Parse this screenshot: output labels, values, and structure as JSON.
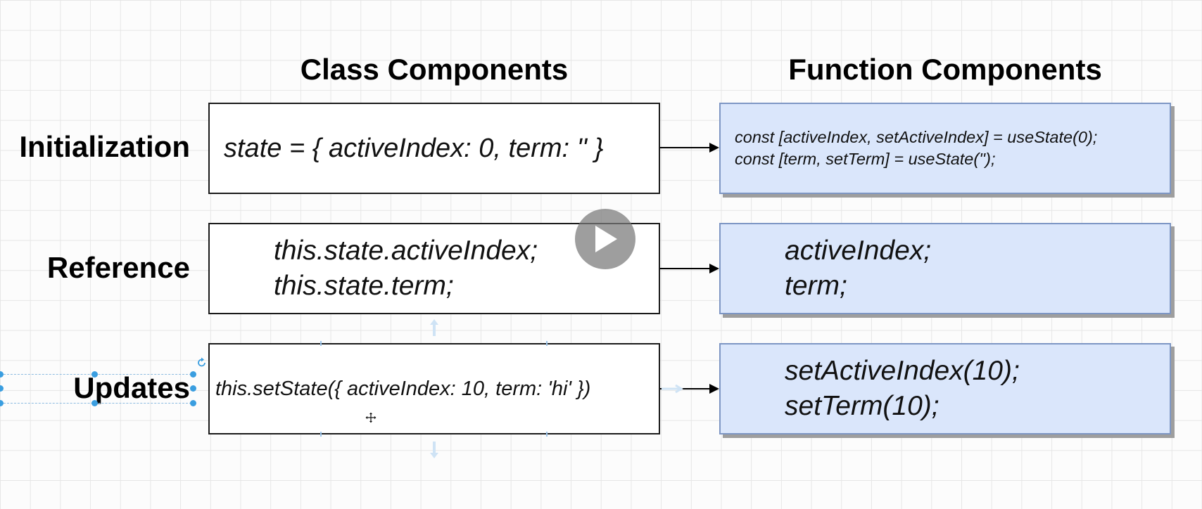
{
  "columns": {
    "class": "Class Components",
    "function": "Function Components"
  },
  "rows": [
    {
      "label": "Initialization",
      "class_lines": [
        "state = { activeIndex: 0, term: '' }"
      ],
      "function_lines": [
        "const [activeIndex, setActiveIndex] = useState(0);",
        "const [term, setTerm] = useState('');"
      ]
    },
    {
      "label": "Reference",
      "class_lines": [
        "this.state.activeIndex;",
        "this.state.term;"
      ],
      "function_lines": [
        "activeIndex;",
        "term;"
      ]
    },
    {
      "label": "Updates",
      "class_lines": [
        "this.setState({ activeIndex: 10, term: 'hi' })"
      ],
      "function_lines": [
        "setActiveIndex(10);",
        "setTerm(10);"
      ]
    }
  ],
  "icons": {
    "play": "play-icon",
    "move_cursor": "move-cursor-icon",
    "rotate_handle": "rotate-icon"
  },
  "colors": {
    "function_fill": "#dae6fb",
    "function_border": "#7d96c4",
    "selection": "#3a9ee0"
  }
}
